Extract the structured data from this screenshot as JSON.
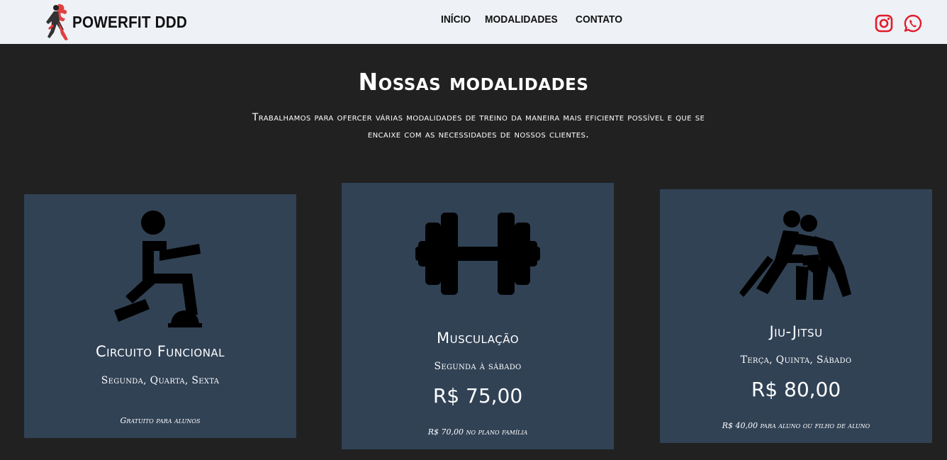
{
  "brand": {
    "name": "POWERFIT DDD",
    "logo_icon": "runner-logo-icon"
  },
  "nav": {
    "items": [
      "INÍCIO",
      "MODALIDADES",
      "CONTATO"
    ]
  },
  "social": {
    "instagram_icon": "instagram-icon",
    "whatsapp_icon": "whatsapp-icon",
    "color": "#e21b2a"
  },
  "section": {
    "title": "Nossas modalidades",
    "subtitle_line1": "Trabalhamos para ofercer várias modalidades de treino da maneira mais eficiente possível e que se",
    "subtitle_line2": "encaixe com as necessidades de nossos clientes."
  },
  "cards": [
    {
      "icon": "lunge-exercise-icon",
      "title": "Circuito Funcional",
      "days": "Segunda, Quarta, Sexta",
      "price": "",
      "note": "Gratuito para alunos"
    },
    {
      "icon": "dumbbell-icon",
      "title": "Musculação",
      "days": "Segunda à sábado",
      "price": "R$ 75,00",
      "note": "R$ 70,00 no plano família"
    },
    {
      "icon": "wrestling-icon",
      "title": "Jiu-Jitsu",
      "days": "Terça, Quinta, Sábado",
      "price": "R$ 80,00",
      "note": "R$ 40,00 para aluno ou filho de aluno"
    }
  ],
  "colors": {
    "nav_bg": "#eef1f6",
    "page_bg": "#212121",
    "card_bg": "#314255",
    "accent": "#e21b2a"
  }
}
